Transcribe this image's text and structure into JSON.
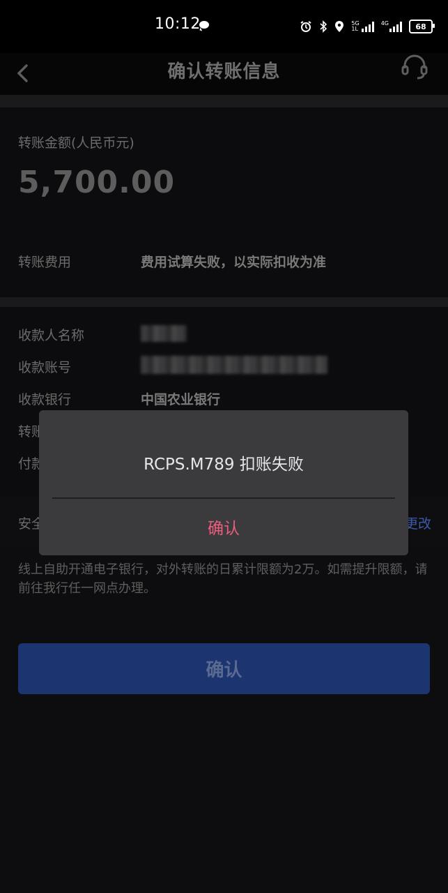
{
  "status_bar": {
    "time": "10:12",
    "net1_top": "5G",
    "net1_bottom": "1L",
    "net2": "4G",
    "battery": "68"
  },
  "header": {
    "title": "确认转账信息"
  },
  "amount": {
    "label": "转账金额(人民币元)",
    "value": "5,700.00"
  },
  "fee": {
    "label": "转账费用",
    "value": "费用试算失败，以实际扣收为准"
  },
  "details": {
    "payee_name_label": "收款人名称",
    "payee_account_label": "收款账号",
    "payee_bank_label": "收款银行",
    "payee_bank_value": "中国农业银行",
    "transfer_label_partial": "转账",
    "payer_label_partial": "付款"
  },
  "security": {
    "label_partial": "安全",
    "change_label_partial": "更改"
  },
  "notice": "线上自助开通电子银行，对外转账的日累计限额为2万。如需提升限额，请前往我行任一网点办理。",
  "confirm_button": "确认",
  "dialog": {
    "message": "RCPS.M789 扣账失败",
    "confirm": "确认"
  },
  "colors": {
    "accent_blue": "#1c3470",
    "dialog_button": "#ec5d7e"
  }
}
